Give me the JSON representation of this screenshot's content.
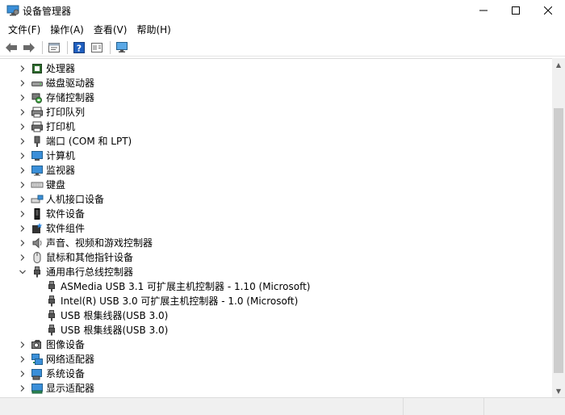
{
  "window": {
    "title": "设备管理器",
    "minimize_glyph": "—",
    "maximize_glyph": "☐",
    "close_glyph": "✕"
  },
  "menu": [
    {
      "label": "文件(F)"
    },
    {
      "label": "操作(A)"
    },
    {
      "label": "查看(V)"
    },
    {
      "label": "帮助(H)"
    }
  ],
  "toolbar": {
    "icons": [
      "back-arrow-icon",
      "forward-arrow-icon",
      "properties-icon",
      "help-icon",
      "update-driver-icon",
      "monitor-scan-icon"
    ]
  },
  "tree": {
    "items": [
      {
        "label": "处理器",
        "icon": "processor-icon",
        "expanded": false,
        "level": 0
      },
      {
        "label": "磁盘驱动器",
        "icon": "disk-drive-icon",
        "expanded": false,
        "level": 0
      },
      {
        "label": "存储控制器",
        "icon": "storage-controller-icon",
        "expanded": false,
        "level": 0
      },
      {
        "label": "打印队列",
        "icon": "print-queue-icon",
        "expanded": false,
        "level": 0
      },
      {
        "label": "打印机",
        "icon": "printer-icon",
        "expanded": false,
        "level": 0
      },
      {
        "label": "端口 (COM 和 LPT)",
        "icon": "port-icon",
        "expanded": false,
        "level": 0
      },
      {
        "label": "计算机",
        "icon": "computer-icon",
        "expanded": false,
        "level": 0
      },
      {
        "label": "监视器",
        "icon": "monitor-icon",
        "expanded": false,
        "level": 0
      },
      {
        "label": "键盘",
        "icon": "keyboard-icon",
        "expanded": false,
        "level": 0
      },
      {
        "label": "人机接口设备",
        "icon": "hid-icon",
        "expanded": false,
        "level": 0
      },
      {
        "label": "软件设备",
        "icon": "software-device-icon",
        "expanded": false,
        "level": 0
      },
      {
        "label": "软件组件",
        "icon": "software-component-icon",
        "expanded": false,
        "level": 0
      },
      {
        "label": "声音、视频和游戏控制器",
        "icon": "speaker-icon",
        "expanded": false,
        "level": 0
      },
      {
        "label": "鼠标和其他指针设备",
        "icon": "mouse-icon",
        "expanded": false,
        "level": 0
      },
      {
        "label": "通用串行总线控制器",
        "icon": "usb-icon",
        "expanded": true,
        "level": 0
      },
      {
        "label": "ASMedia USB 3.1 可扩展主机控制器 - 1.10 (Microsoft)",
        "icon": "usb-icon",
        "level": 1
      },
      {
        "label": "Intel(R) USB 3.0 可扩展主机控制器 - 1.0 (Microsoft)",
        "icon": "usb-icon",
        "level": 1
      },
      {
        "label": "USB 根集线器(USB 3.0)",
        "icon": "usb-icon",
        "level": 1
      },
      {
        "label": "USB 根集线器(USB 3.0)",
        "icon": "usb-icon",
        "level": 1
      },
      {
        "label": "图像设备",
        "icon": "camera-icon",
        "expanded": false,
        "level": 0
      },
      {
        "label": "网络适配器",
        "icon": "network-adapter-icon",
        "expanded": false,
        "level": 0
      },
      {
        "label": "系统设备",
        "icon": "system-device-icon",
        "expanded": false,
        "level": 0
      },
      {
        "label": "显示适配器",
        "icon": "display-adapter-icon",
        "expanded": false,
        "level": 0
      }
    ]
  },
  "colors": {
    "monitor_blue": "#3a8fd9",
    "help_blue": "#1f5fbf",
    "chevron": "#444444"
  }
}
